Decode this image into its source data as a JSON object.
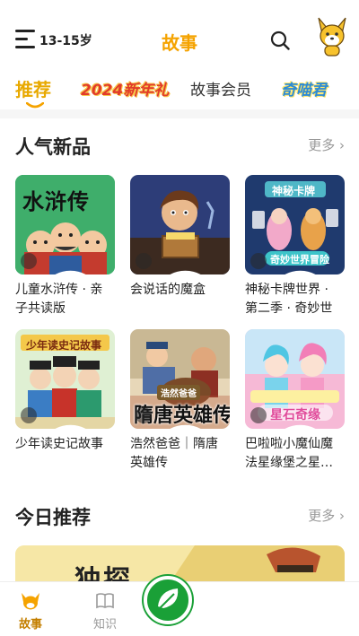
{
  "header": {
    "age_range": "13-15岁",
    "title": "故事",
    "menu_icon": "menu-icon",
    "search_icon": "search-icon",
    "avatar_icon": "fox-mascot-icon"
  },
  "tabs": [
    {
      "label": "推荐",
      "active": true
    },
    {
      "label": "2024新年礼",
      "logo": true
    },
    {
      "label": "故事会员"
    },
    {
      "label": "奇喵君",
      "logo": true
    }
  ],
  "sections": {
    "popular": {
      "title": "人气新品",
      "more": "更多 ›",
      "items": [
        {
          "title": "儿童水浒传 · 亲子共读版",
          "cover_text": "水浒传",
          "color": "#3fae6b"
        },
        {
          "title": "会说话的魔盒",
          "cover_text": "",
          "color": "#2d3d78"
        },
        {
          "title": "神秘卡牌世界 · 第二季 · 奇妙世界…",
          "cover_text": "神秘卡牌",
          "cover_sub": "奇妙世界冒险",
          "color": "#1f3a6e"
        },
        {
          "title": "少年读史记故事",
          "cover_text": "少年读史记故事",
          "color": "#dff0d3"
        },
        {
          "title": "浩然爸爸｜隋唐英雄传",
          "cover_text": "隋唐英雄传",
          "cover_sub": "浩然爸爸",
          "color": "#b4563a"
        },
        {
          "title": "巴啦啦小魔仙魔法星缘堡之星…",
          "cover_text": "星石奇缘",
          "color": "#f6b9d6"
        }
      ]
    },
    "today": {
      "title": "今日推荐",
      "more": "更多 ›",
      "banner_text": "独探"
    }
  },
  "bottom_nav": [
    {
      "label": "故事",
      "icon": "fox-mascot-icon",
      "active": true
    },
    {
      "label": "知识",
      "icon": "book-icon",
      "active": false
    }
  ],
  "colors": {
    "accent": "#f5a300",
    "active_tab": "#e8a900",
    "fab": "#1aa037",
    "muted": "#999999"
  }
}
